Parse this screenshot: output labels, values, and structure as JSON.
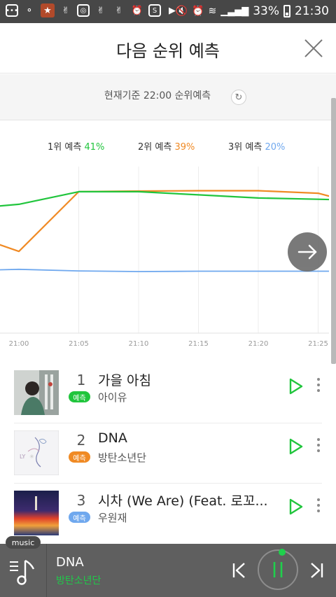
{
  "status_bar": {
    "battery": "33%",
    "time": "21:30"
  },
  "header": {
    "title": "다음 순위 예측"
  },
  "basis": {
    "text": "현재기준 22:00 순위예측"
  },
  "legend": [
    {
      "label": "1위 예측",
      "percent": "41%",
      "color": "#21c53d"
    },
    {
      "label": "2위 예측",
      "percent": "39%",
      "color": "#f08a24"
    },
    {
      "label": "3위 예측",
      "percent": "20%",
      "color": "#6fa8ee"
    }
  ],
  "chart_data": {
    "type": "line",
    "x": [
      "20:57",
      "21:00",
      "21:05",
      "21:10",
      "21:15",
      "21:20",
      "21:25",
      "21:26"
    ],
    "x_ticks": [
      "21:00",
      "21:05",
      "21:10",
      "21:15",
      "21:20",
      "21:25"
    ],
    "series": [
      {
        "name": "1위 예측",
        "color": "#21c53d",
        "values": [
          40,
          41,
          45,
          45,
          44,
          43,
          42.6,
          42.5
        ]
      },
      {
        "name": "2위 예측",
        "color": "#f08a24",
        "values": [
          30,
          26,
          45,
          45.2,
          45.3,
          45.3,
          44.5,
          43.5
        ]
      },
      {
        "name": "3위 예측",
        "color": "#6fa8ee",
        "values": [
          20,
          20.3,
          19.8,
          19.6,
          19.7,
          19.7,
          19.7,
          19.7
        ]
      }
    ],
    "ylim": [
      0,
      57
    ],
    "grid": true
  },
  "songs": [
    {
      "rank": "1",
      "badge": "예측",
      "badge_color": "#21c53d",
      "title": "가을 아침",
      "artist": "아이유"
    },
    {
      "rank": "2",
      "badge": "예측",
      "badge_color": "#f08a24",
      "title": "DNA",
      "artist": "방탄소년단"
    },
    {
      "rank": "3",
      "badge": "예측",
      "badge_color": "#6fa8ee",
      "title": "시차 (We Are) (Feat. 로꼬...",
      "artist": "우원재"
    }
  ],
  "player": {
    "tag": "music",
    "title": "DNA",
    "artist": "방탄소년단"
  }
}
